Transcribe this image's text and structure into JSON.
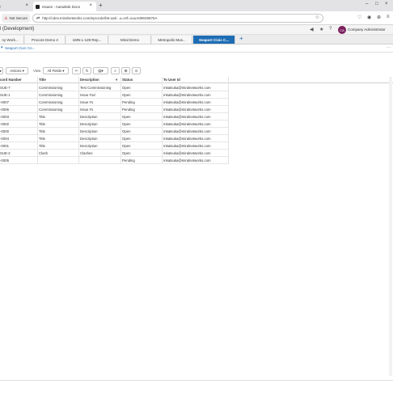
{
  "browser": {
    "inactive_tab_label": "ar",
    "active_tab_label": "Issues - Autodesk Docs",
    "new_tab_symbol": "+",
    "close_symbol": "×",
    "not_secure_label": "Not Secure",
    "url": "http://cdev.miralnetworks.com/eprocde/b5-uat/...u=ref=ouuA09849876A",
    "star_symbol": "☆",
    "window_controls": [
      "–",
      "□",
      "×"
    ]
  },
  "app": {
    "title": "l (Development)",
    "user_initials": "CA",
    "user_name": "Company Administrator"
  },
  "app_tabs": [
    {
      "label": "ny Work...",
      "selected": false
    },
    {
      "label": "Procore Demo 2",
      "selected": false
    },
    {
      "label": "1MN-L-129 Rep...",
      "selected": false
    },
    {
      "label": "Miral Demo",
      "selected": false
    },
    {
      "label": "Metropolis Mus...",
      "selected": false
    },
    {
      "label": "Seaport Civic C...",
      "selected": true
    }
  ],
  "breadcrumb": {
    "label": "Seaport Civic Ce..."
  },
  "toolbar": {
    "actions_label": "Actions",
    "view_label": "View",
    "view_value": "All Fields"
  },
  "grid": {
    "columns": [
      "cord Number",
      "Title",
      "Description",
      "Status",
      "To User Id"
    ],
    "rows": [
      [
        "SUE-7",
        "Commissioning",
        "Test Commissioning",
        "Open",
        "mkatsuka@miralnetworks.com"
      ],
      [
        "SUE-1",
        "Commissioning",
        "Issue #1d",
        "Open",
        "mkatsuka@miralnetworks.com"
      ],
      [
        "-0007",
        "Commissioning",
        "Issue #1",
        "Pending",
        "mkatsuka@miralnetworks.com"
      ],
      [
        "-0006",
        "Commissioning",
        "Issue #1",
        "Pending",
        "mkatsuka@miralnetworks.com"
      ],
      [
        "-0003",
        "Title",
        "Description",
        "Open",
        "mkatsuka@miralnetworks.com"
      ],
      [
        "-0002",
        "Title",
        "Description",
        "Open",
        "mkatsuka@miralnetworks.com"
      ],
      [
        "-0000",
        "Title",
        "Description",
        "Open",
        "mkatsuka@miralnetworks.com"
      ],
      [
        "-0004",
        "Title",
        "Description",
        "Open",
        "mkatsuka@miralnetworks.com"
      ],
      [
        "-0001",
        "Title",
        "Description",
        "Open",
        "mkatsuka@miralnetworks.com"
      ],
      [
        "SUE-2",
        "Clash",
        "Clashes",
        "Open",
        "mkatsuka@miralnetworks.com"
      ],
      [
        "-0005",
        "",
        "",
        "Pending",
        "mkatsuka@miralnetworks.com"
      ]
    ]
  },
  "colors": {
    "accent": "#1e6db4",
    "avatar": "#7a1f5c"
  }
}
